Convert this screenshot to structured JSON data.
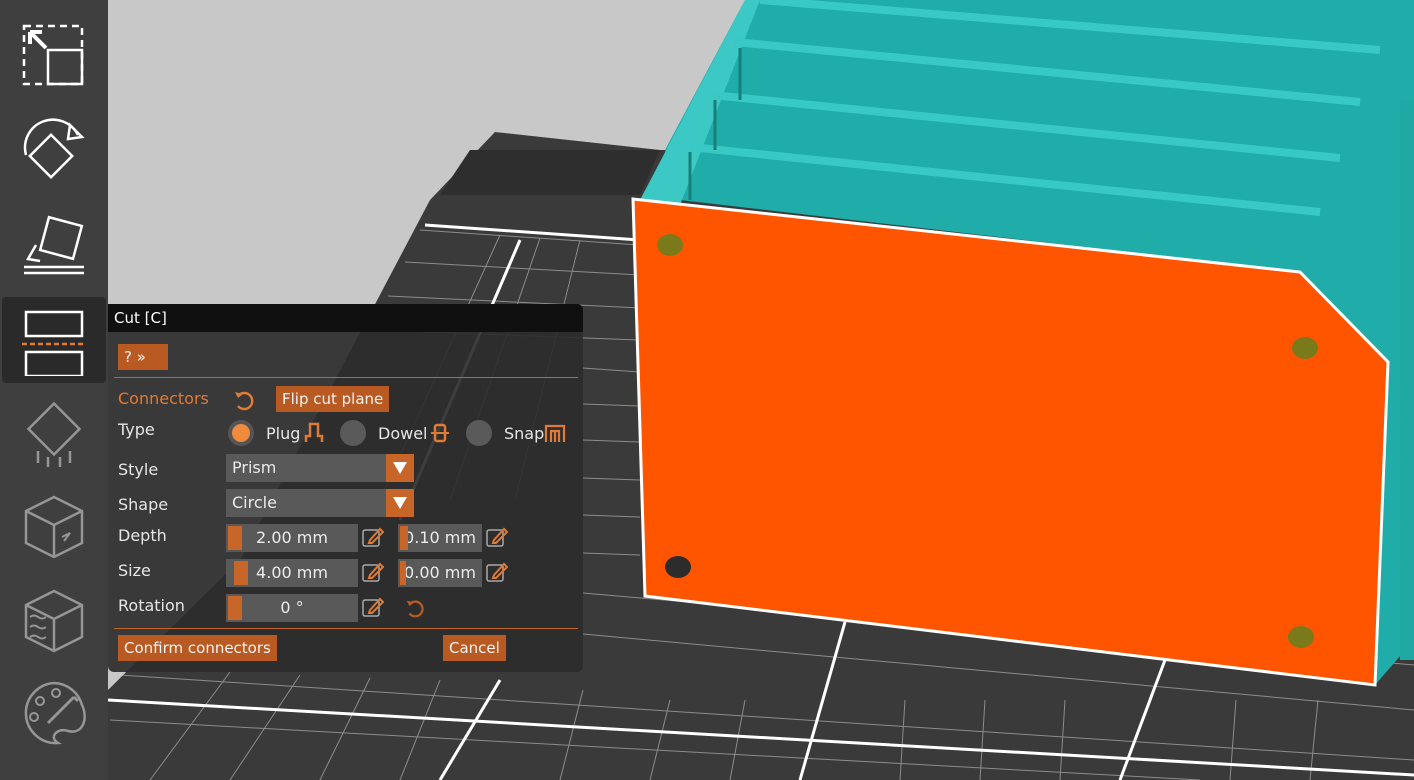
{
  "colors": {
    "accent": "#c8662a",
    "accent_text": "#e07a35",
    "part_face": "#ff5a00",
    "part_body": "#1fb5b0",
    "bed": "#3a3a3a",
    "grid": "#ffffff"
  },
  "toolbar": {
    "items": [
      {
        "name": "scale",
        "icon": "scale-icon"
      },
      {
        "name": "rotate",
        "icon": "rotate-icon"
      },
      {
        "name": "place-on-face",
        "icon": "place-on-face-icon"
      },
      {
        "name": "cut",
        "icon": "cut-icon",
        "active": true
      },
      {
        "name": "supports",
        "icon": "supports-paint-icon"
      },
      {
        "name": "seam",
        "icon": "seam-paint-icon"
      },
      {
        "name": "fuzzy-skin",
        "icon": "fuzzy-skin-icon"
      },
      {
        "name": "color-paint",
        "icon": "color-paint-icon"
      }
    ]
  },
  "cut_dialog": {
    "title": "Cut [C]",
    "help_button": "? »",
    "connectors_label": "Connectors",
    "flip_button": "Flip cut plane",
    "type_label": "Type",
    "types": [
      {
        "label": "Plug",
        "selected": true
      },
      {
        "label": "Dowel",
        "selected": false
      },
      {
        "label": "Snap",
        "selected": false
      }
    ],
    "style_label": "Style",
    "style_value": "Prism",
    "shape_label": "Shape",
    "shape_value": "Circle",
    "depth_label": "Depth",
    "depth_value": "2.00  mm",
    "depth_tolerance": "0.10  mm",
    "size_label": "Size",
    "size_value": "4.00  mm",
    "size_tolerance": "0.00  mm",
    "rotation_label": "Rotation",
    "rotation_value": "0 °",
    "confirm_button": "Confirm connectors",
    "cancel_button": "Cancel"
  }
}
